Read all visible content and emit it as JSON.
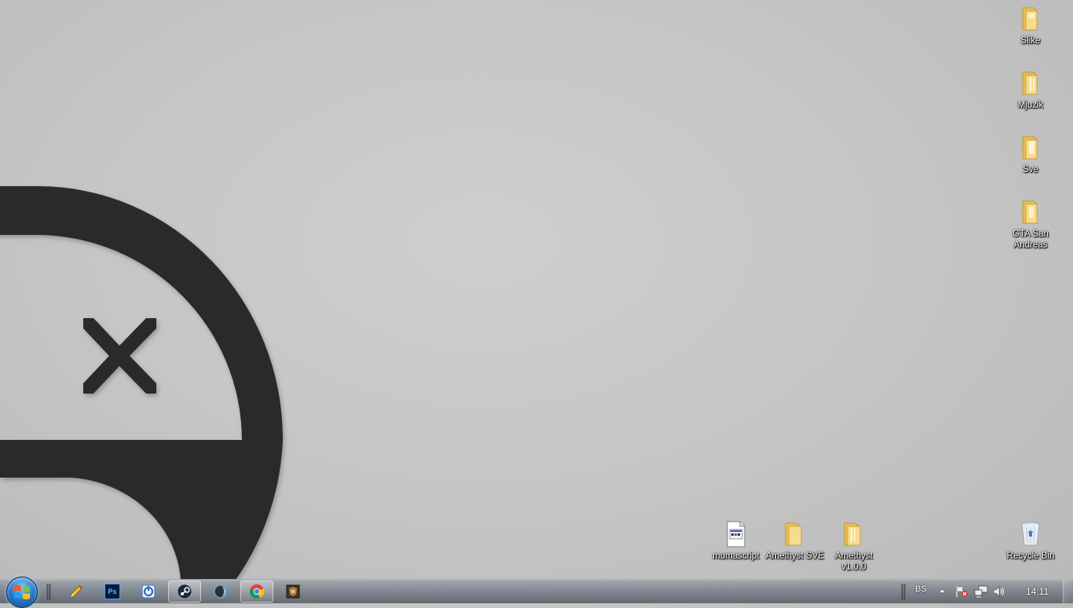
{
  "desktop": {
    "icons_right": [
      {
        "label": "Slike",
        "kind": "folder"
      },
      {
        "label": "Mjuzik",
        "kind": "folder"
      },
      {
        "label": "Sve",
        "kind": "folder"
      },
      {
        "label": "GTA San Andreas",
        "kind": "folder"
      }
    ],
    "icons_bottom": [
      {
        "label": "mumascript",
        "kind": "script-file"
      },
      {
        "label": "Amethyst SVE",
        "kind": "folder"
      },
      {
        "label": "Amethyst v1.0.0",
        "kind": "folder"
      },
      {
        "label": "Recycle Bin",
        "kind": "recycle-bin"
      }
    ]
  },
  "taskbar": {
    "pinned": [
      {
        "name": "pencil-app",
        "icon": "pencil-icon"
      },
      {
        "name": "photoshop",
        "icon": "photoshop-icon",
        "text": "Ps"
      },
      {
        "name": "uplay",
        "icon": "uplay-icon"
      },
      {
        "name": "steam",
        "icon": "steam-icon",
        "active": true
      },
      {
        "name": "app-circle",
        "icon": "circle-app-icon"
      },
      {
        "name": "chrome",
        "icon": "chrome-icon",
        "active": true
      },
      {
        "name": "game",
        "icon": "game-icon"
      }
    ],
    "tray": {
      "language": "BS",
      "clock": "14:11"
    }
  },
  "colors": {
    "wallpaper_bg": "#c6c6c6",
    "wallpaper_mark": "#2a2a2a",
    "folder_yellow": "#f2cf6a"
  }
}
